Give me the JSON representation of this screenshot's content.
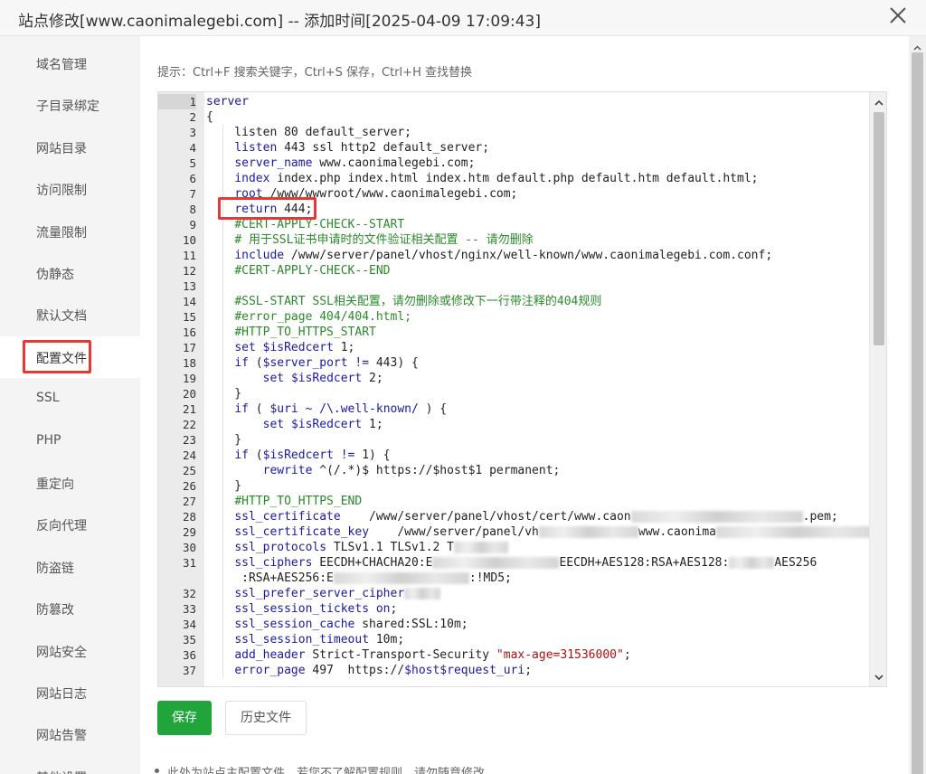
{
  "window": {
    "title": "站点修改[www.caonimalegebi.com] -- 添加时间[2025-04-09 17:09:43]",
    "close_icon": "close-icon"
  },
  "sidebar": {
    "items": [
      {
        "label": "域名管理"
      },
      {
        "label": "子目录绑定"
      },
      {
        "label": "网站目录"
      },
      {
        "label": "访问限制"
      },
      {
        "label": "流量限制"
      },
      {
        "label": "伪静态"
      },
      {
        "label": "默认文档"
      },
      {
        "label": "配置文件",
        "active": true
      },
      {
        "label": "SSL"
      },
      {
        "label": "PHP"
      },
      {
        "label": "重定向"
      },
      {
        "label": "反向代理"
      },
      {
        "label": "防盗链"
      },
      {
        "label": "防篡改"
      },
      {
        "label": "网站安全"
      },
      {
        "label": "网站日志"
      },
      {
        "label": "网站告警"
      },
      {
        "label": "其他设置"
      }
    ]
  },
  "main": {
    "tip": "提示：Ctrl+F 搜索关键字，Ctrl+S 保存，Ctrl+H 查找替换",
    "editor": {
      "active_line": 1,
      "lines": [
        {
          "n": "1",
          "html": "<span class=\"kw\">server</span>"
        },
        {
          "n": "2",
          "html": "{"
        },
        {
          "n": "3",
          "html": "    listen 80 default_server;"
        },
        {
          "n": "4",
          "html": "    <span class=\"kw\">listen</span> 443 ssl http2 default_server;"
        },
        {
          "n": "5",
          "html": "    <span class=\"kw\">server_name</span> www.caonimalegebi.com;"
        },
        {
          "n": "6",
          "html": "    <span class=\"kw\">index</span> index.php index.html index.htm default.php default.htm default.html;"
        },
        {
          "n": "7",
          "html": "    <span class=\"kw\">root</span> /www/wwwroot/www.caonimalegebi.com;"
        },
        {
          "n": "8",
          "html": "    <span class=\"kw\">return</span> 444;"
        },
        {
          "n": "9",
          "html": "    <span class=\"cm\">#CERT-APPLY-CHECK--START</span>"
        },
        {
          "n": "10",
          "html": "    <span class=\"cm\"># 用于SSL证书申请时的文件验证相关配置 -- 请勿删除</span>"
        },
        {
          "n": "11",
          "html": "    <span class=\"kw\">include</span> /www/server/panel/vhost/nginx/well-known/www.caonimalegebi.com.conf;"
        },
        {
          "n": "12",
          "html": "    <span class=\"cm\">#CERT-APPLY-CHECK--END</span>"
        },
        {
          "n": "13",
          "html": ""
        },
        {
          "n": "14",
          "html": "    <span class=\"cm\">#SSL-START SSL相关配置，请勿删除或修改下一行带注释的404规则</span>"
        },
        {
          "n": "15",
          "html": "    <span class=\"cm\">#error_page 404/404.html;</span>"
        },
        {
          "n": "16",
          "html": "    <span class=\"cm\">#HTTP_TO_HTTPS_START</span>"
        },
        {
          "n": "17",
          "html": "    <span class=\"kw\">set</span> <span class=\"var\">$isRedcert</span> 1;"
        },
        {
          "n": "18",
          "html": "    <span class=\"kw\">if</span> (<span class=\"var\">$server_port</span> <span class=\"kw\">!=</span> 443) {"
        },
        {
          "n": "19",
          "html": "        <span class=\"kw\">set</span> <span class=\"var\">$isRedcert</span> 2;"
        },
        {
          "n": "20",
          "html": "    }"
        },
        {
          "n": "21",
          "html": "    <span class=\"kw\">if</span> ( <span class=\"var\">$uri</span> <span class=\"kw\">~</span> <span class=\"kw\">/\\.well-known/</span> ) {"
        },
        {
          "n": "22",
          "html": "        <span class=\"kw\">set</span> <span class=\"var\">$isRedcert</span> 1;"
        },
        {
          "n": "23",
          "html": "    }"
        },
        {
          "n": "24",
          "html": "    <span class=\"kw\">if</span> (<span class=\"var\">$isRedcert</span> <span class=\"kw\">!=</span> 1) {"
        },
        {
          "n": "25",
          "html": "        <span class=\"kw\">rewrite</span> ^(/.*)$ https://$host$1 permanent;"
        },
        {
          "n": "26",
          "html": "    }"
        },
        {
          "n": "27",
          "html": "    <span class=\"cm\">#HTTP_TO_HTTPS_END</span>"
        },
        {
          "n": "28",
          "html": "    <span class=\"kw\">ssl_certificate</span>    /www/server/panel/vhost/cert/www.caon<span class=\"blur\" style=\"width:190px\"></span>.pem;"
        },
        {
          "n": "29",
          "html": "    <span class=\"kw\">ssl_certificate_key</span>    /www/server/panel/vh<span class=\"blur\" style=\"width:110px\"></span>www.caonima<span class=\"blur\" style=\"width:180px\"></span>"
        },
        {
          "n": "30",
          "html": "    <span class=\"kw\">ssl_protocols</span> TLSv1.1 TLSv1.2 T<span class=\"blur\" style=\"width:60px\"></span>"
        },
        {
          "n": "31",
          "html": "    <span class=\"kw\">ssl_ciphers</span> EECDH+CHACHA20:E<span class=\"blur\" style=\"width:140px\"></span>EECDH+AES128:RSA+AES128:<span class=\"blur\" style=\"width:50px\"></span>AES256"
        },
        {
          "n": "",
          "html": "     :RSA+AES256:E<span class=\"blur\" style=\"width:150px\"></span>:!MD5;"
        },
        {
          "n": "32",
          "html": "    <span class=\"kw\">ssl_prefer_server_cipher</span><span class=\"blur\" style=\"width:40px\"></span>"
        },
        {
          "n": "33",
          "html": "    <span class=\"kw\">ssl_session_tickets</span> <span class=\"var\">on</span>;"
        },
        {
          "n": "34",
          "html": "    <span class=\"kw\">ssl_session_cache</span> shared:SSL:10m;"
        },
        {
          "n": "35",
          "html": "    <span class=\"kw\">ssl_session_timeout</span> 10m;"
        },
        {
          "n": "36",
          "html": "    <span class=\"kw\">add_header</span> Strict-Transport-Security <span class=\"str\">\"max-age=31536000\"</span>;"
        },
        {
          "n": "37",
          "html": "    <span class=\"kw\">error_page</span> 497  https://<span class=\"var\">$host$request_uri</span>;"
        }
      ]
    },
    "save_button": "保存",
    "history_button": "历史文件",
    "note": "此处为站点主配置文件，若您不了解配置规则，请勿随意修改。"
  },
  "colors": {
    "accent": "#20a53a",
    "highlight": "#e53935",
    "keyword": "#1a1aa6",
    "comment": "#2a8a2a"
  }
}
